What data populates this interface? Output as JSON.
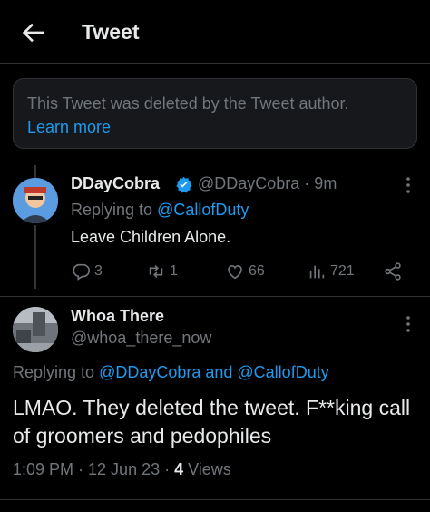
{
  "header": {
    "title": "Tweet"
  },
  "deleted_notice": {
    "text": "This Tweet was deleted by the Tweet author.",
    "link": "Learn more"
  },
  "reply_tweet": {
    "author": "DDayCobra",
    "handle_time": "@DDayCobra · 9m",
    "replying_prefix": "Replying to ",
    "replying_to": "@CallofDuty",
    "text": "Leave Children Alone.",
    "replies": "3",
    "retweets": "1",
    "likes": "66",
    "views": "721"
  },
  "main_tweet": {
    "author": "Whoa There",
    "handle": "@whoa_there_now",
    "replying_prefix": "Replying to ",
    "replying_to": "@DDayCobra and @CallofDuty",
    "text": "LMAO. They deleted the tweet. F**king call of groomers and pedophiles",
    "timestamp": "1:09 PM · 12 Jun 23 · ",
    "views_count": "4",
    "views_label": " Views"
  },
  "colors": {
    "accent": "#1d9bf0",
    "muted": "#71767b",
    "text": "#e7e9ea",
    "background": "#000000"
  },
  "icons": [
    "back-arrow-icon",
    "verified-badge-icon",
    "more-icon",
    "reply-icon",
    "retweet-icon",
    "like-icon",
    "views-icon",
    "share-icon"
  ]
}
